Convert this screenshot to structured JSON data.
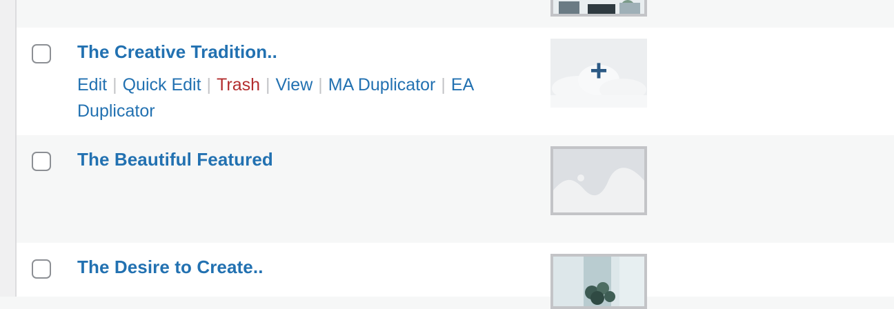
{
  "rows": [
    {
      "title": "The Creative Tradition..",
      "actions": {
        "edit": "Edit",
        "quick_edit": "Quick Edit",
        "trash": "Trash",
        "view": "View",
        "ma_duplicator": "MA Duplicator",
        "ea_duplicator": "EA Duplicator"
      },
      "thumb_icon": "plus-icon",
      "thumb_symbol": "+"
    },
    {
      "title": "The Beautiful Featured",
      "thumb_icon": "image-placeholder-icon"
    },
    {
      "title": "The Desire to Create..",
      "thumb_icon": "plant-photo"
    }
  ],
  "colors": {
    "link": "#2271b1",
    "trash": "#b32d2e",
    "separator": "#c3c4c7",
    "row_alt": "#f6f7f7"
  }
}
